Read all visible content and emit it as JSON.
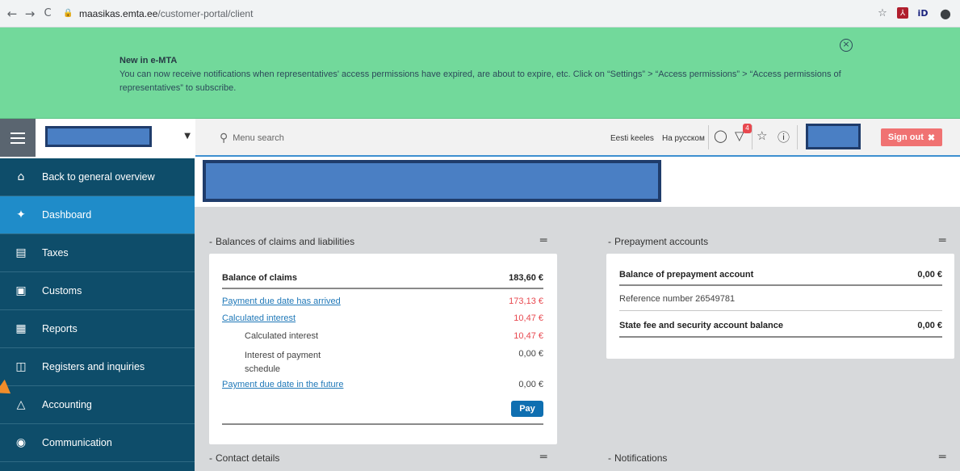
{
  "browser": {
    "back": "←",
    "forward": "→",
    "reload": "C",
    "url_host": "maasikas.emta.ee",
    "url_path": "/customer-portal/client",
    "star": "☆",
    "pdf": "⅄",
    "id": "iD",
    "profile": "⊖"
  },
  "banner": {
    "title": "New in e-MTA",
    "text": "You can now receive notifications when representatives' access permissions have expired, are about to expire, etc. Click on “Settings” > “Access permissions” > “Access permissions of representatives” to subscribe.",
    "close": "×"
  },
  "header": {
    "search_placeholder": "Menu search",
    "lang_et": "Eesti keeles",
    "lang_ru": "На русском",
    "notification_count": "4",
    "signout_label": "Sign out",
    "signout_icon": "✖"
  },
  "sidebar": {
    "items": [
      {
        "label": "Back to general overview",
        "icon": "home-icon"
      },
      {
        "label": "Dashboard",
        "icon": "dashboard-icon"
      },
      {
        "label": "Taxes",
        "icon": "bank-icon"
      },
      {
        "label": "Customs",
        "icon": "truck-icon"
      },
      {
        "label": "Reports",
        "icon": "report-icon"
      },
      {
        "label": "Registers and inquiries",
        "icon": "book-icon"
      },
      {
        "label": "Accounting",
        "icon": "accounting-icon"
      },
      {
        "label": "Communication",
        "icon": "chat-icon"
      }
    ]
  },
  "balances": {
    "heading": "Balances of claims and liabilities",
    "collapse": "-",
    "rows": [
      {
        "label": "Balance of claims",
        "value": "183,60 €"
      },
      {
        "label": "Payment due date has arrived",
        "value": "173,13 €"
      },
      {
        "label": "Calculated interest",
        "value": "10,47 €"
      },
      {
        "label": "Calculated interest",
        "value": "10,47 €"
      },
      {
        "label": "Interest of payment schedule",
        "value": "0,00 €"
      },
      {
        "label": "Payment due date in the future",
        "value": "0,00 €"
      }
    ],
    "pay_label": "Pay"
  },
  "prepayment": {
    "heading": "Prepayment accounts",
    "collapse": "-",
    "balance_label": "Balance of prepayment account",
    "balance_value": "0,00 €",
    "reference": "Reference number 26549781",
    "state_fee_label": "State fee and security account balance",
    "state_fee_value": "0,00 €"
  },
  "contact": {
    "heading": "Contact details",
    "collapse": "-"
  },
  "notifications": {
    "heading": "Notifications",
    "collapse": "-"
  },
  "colors": {
    "banner": "#72d99b",
    "sidebar": "#0e4d6a",
    "sidebar_active": "#1f8cc9",
    "signout": "#f07272",
    "link": "#1f78b8",
    "negative": "#e8484f"
  }
}
